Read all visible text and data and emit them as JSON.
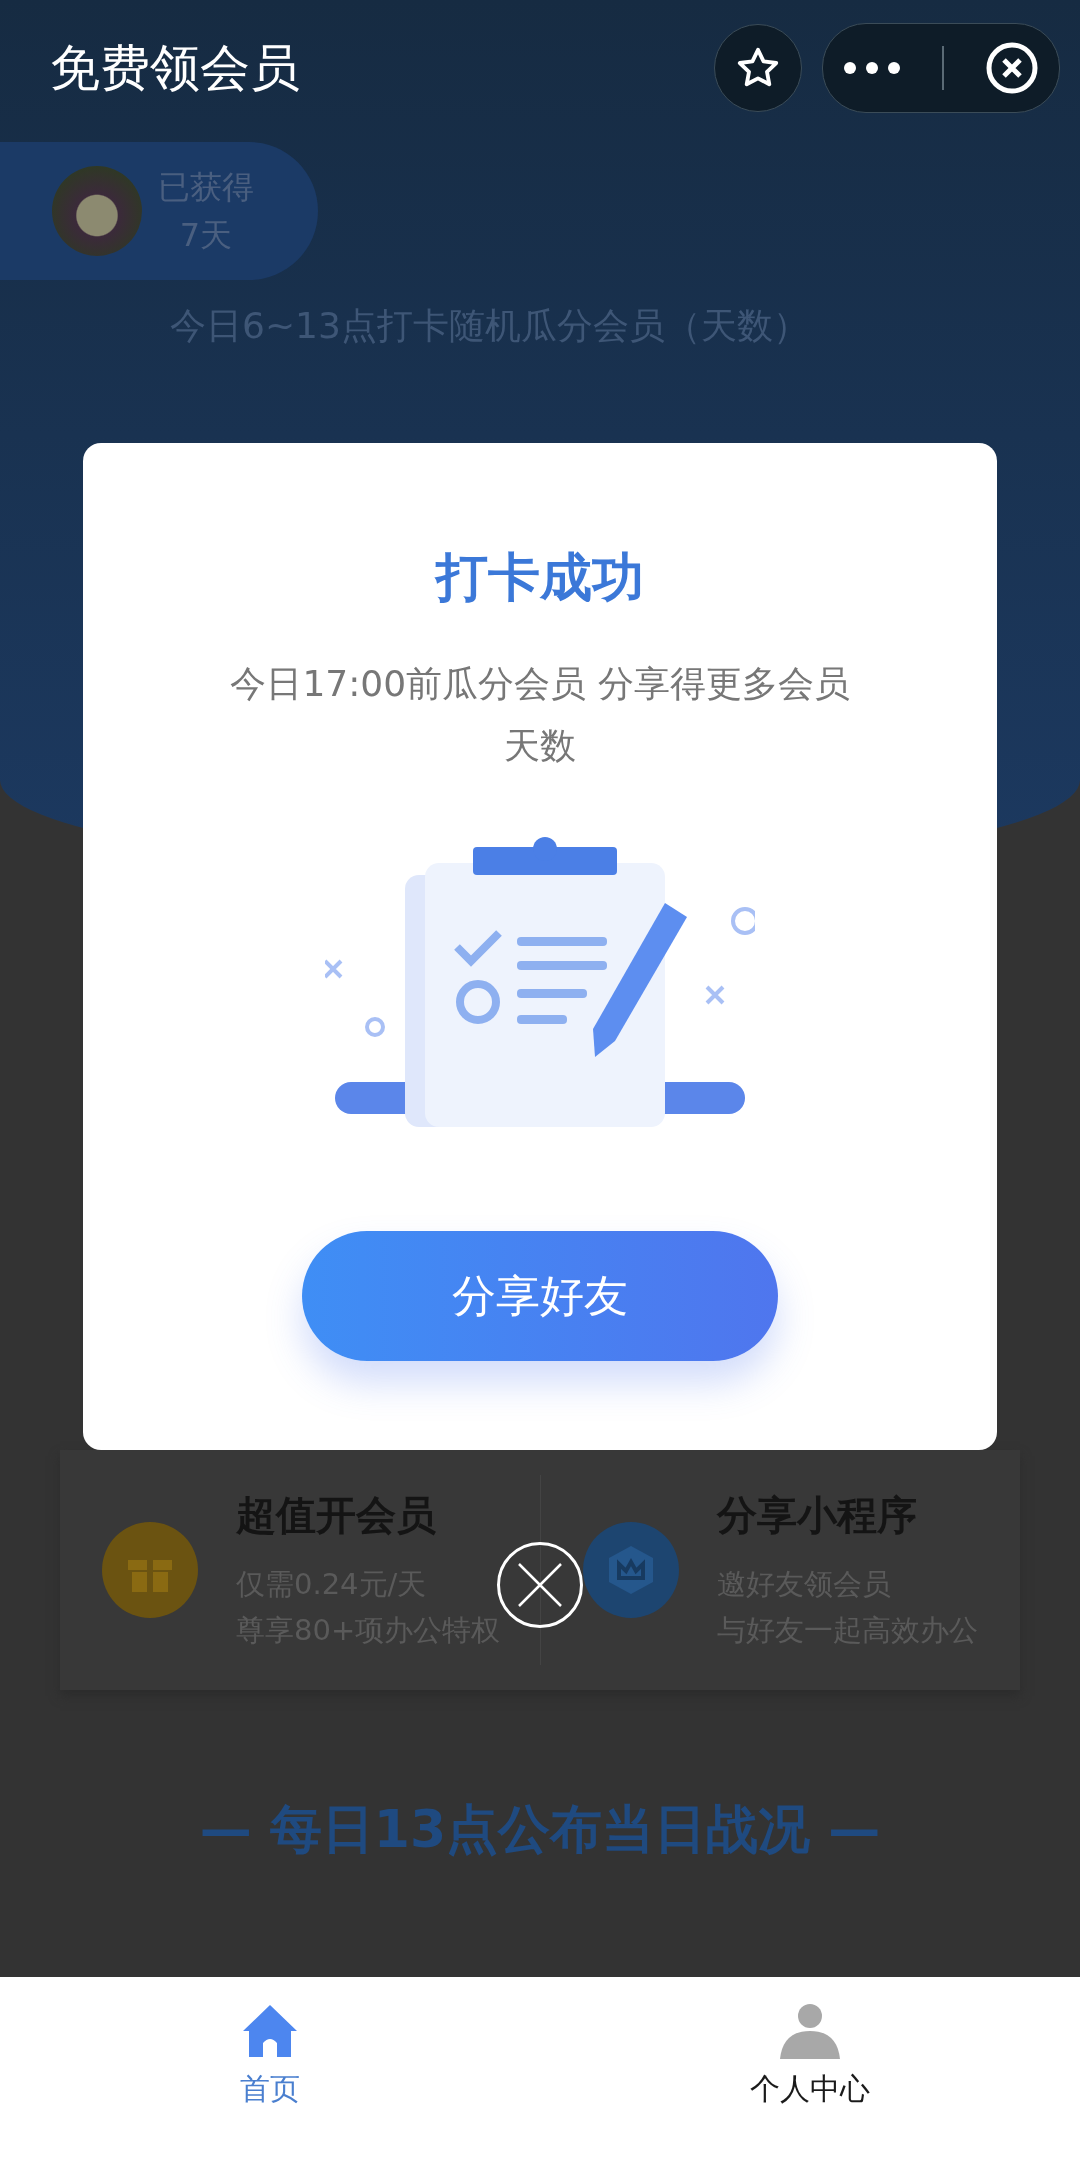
{
  "header": {
    "title": "免费领会员"
  },
  "earned": {
    "label": "已获得",
    "days": "7天"
  },
  "subtitle": "今日6~13点打卡随机瓜分会员（天数）",
  "modal": {
    "title": "打卡成功",
    "message": "今日17:00前瓜分会员 分享得更多会员天数",
    "button": "分享好友"
  },
  "offers": [
    {
      "kind": "gift",
      "title": "超值开会员",
      "lines": [
        "仅需0.24元/天",
        "尊享80+项办公特权"
      ]
    },
    {
      "kind": "crown",
      "title": "分享小程序",
      "lines": [
        "邀好友领会员",
        "与好友一起高效办公"
      ]
    }
  ],
  "section_heading": "— 每日13点公布当日战况 —",
  "tabs": [
    {
      "label": "首页",
      "kind": "home",
      "selected": true
    },
    {
      "label": "个人中心",
      "kind": "person",
      "selected": false
    }
  ]
}
